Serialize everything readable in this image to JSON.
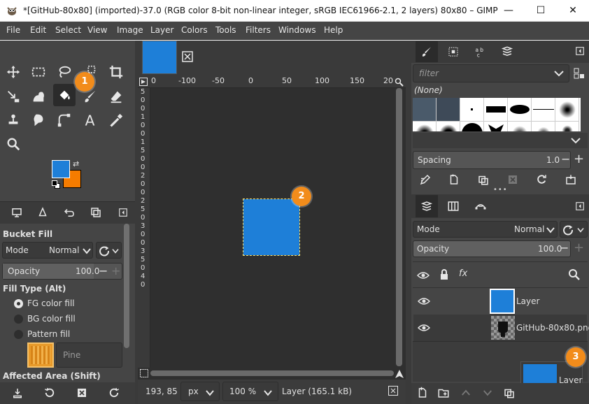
{
  "window": {
    "title": "*[GitHub-80x80] (imported)-37.0 (RGB color 8-bit non-linear integer, sRGB IEC61966-2.1, 2 layers) 80x80 – GIMP",
    "minimize": "—",
    "maximize": "☐",
    "close": "✕"
  },
  "menu": [
    "File",
    "Edit",
    "Select",
    "View",
    "Image",
    "Layer",
    "Colors",
    "Tools",
    "Filters",
    "Windows",
    "Help"
  ],
  "colors": {
    "foreground": "#1e7fd8",
    "background": "#f57c00",
    "badge": "#f28c1b",
    "canvas_fill": "#1e7fd8"
  },
  "toolbox": {
    "icons": [
      "move-icon",
      "rect-select-icon",
      "lasso-icon",
      "fuzzy-select-icon",
      "crop-icon",
      "unified-transform-icon",
      "warp-icon",
      "bucket-fill-icon",
      "paintbrush-icon",
      "eraser-icon",
      "clone-icon",
      "smudge-icon",
      "paths-icon",
      "text-icon",
      "color-picker-icon",
      "zoom-icon"
    ],
    "active": "bucket-fill-icon"
  },
  "tool_options": {
    "title": "Bucket Fill",
    "mode_label": "Mode",
    "mode_value": "Normal",
    "opacity_label": "Opacity",
    "opacity_value": "100.0",
    "fill_type_label": "Fill Type  (Alt)",
    "fill_options": [
      "FG color fill",
      "BG color fill",
      "Pattern fill"
    ],
    "fill_selected": 0,
    "pattern_name": "Pine",
    "affected_area_label": "Affected Area  (Shift)"
  },
  "canvas": {
    "tab_icon": "close-icon",
    "ruler_h_ticks": [
      "0",
      "-100",
      "-50",
      "0",
      "50",
      "100",
      "150",
      "20"
    ],
    "ruler_v_ticks": [
      "5",
      "0",
      "0",
      "1",
      "0",
      "0",
      "1",
      "5",
      "0",
      "0",
      "2",
      "0",
      "0",
      "2",
      "5",
      "0",
      "3",
      "0",
      "0",
      "3",
      "5",
      "0",
      "4",
      "0",
      "0"
    ]
  },
  "statusbar": {
    "coords": "193, 85",
    "unit": "px",
    "zoom": "100 %",
    "info": "Layer (165.1 kB)"
  },
  "brushes": {
    "filter_placeholder": "filter",
    "current": "(None)",
    "spacing_label": "Spacing",
    "spacing_value": "1.0"
  },
  "layers": {
    "mode_label": "Mode",
    "mode_value": "Normal",
    "opacity_label": "Opacity",
    "opacity_value": "100.0",
    "items": [
      {
        "name": "Layer",
        "visible": true
      },
      {
        "name": "GitHub-80x80.png",
        "visible": true
      }
    ],
    "drag_preview_label": "Layer"
  },
  "badges": [
    "1",
    "2",
    "3"
  ]
}
